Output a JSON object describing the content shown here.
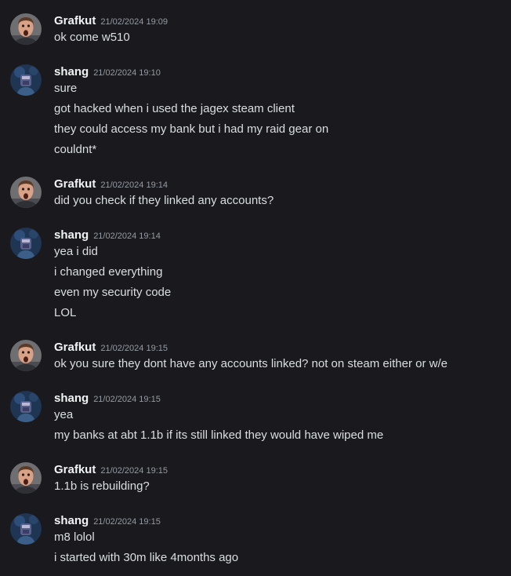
{
  "colors": {
    "background": "#1a1a1e",
    "author": "#f2f3f5",
    "timestamp": "#949ba4",
    "message_text": "#dbdee1"
  },
  "avatars": {
    "grafkut": "man-shocked-face-avatar",
    "shang": "dark-blue-character-avatar"
  },
  "messages": [
    {
      "author": "Grafkut",
      "timestamp": "21/02/2024 19:09",
      "lines": [
        "ok come w510"
      ]
    },
    {
      "author": "shang",
      "timestamp": "21/02/2024 19:10",
      "lines": [
        "sure",
        "got hacked when i used the jagex steam client",
        "they could access my bank but i had my raid gear on",
        "couldnt*"
      ]
    },
    {
      "author": "Grafkut",
      "timestamp": "21/02/2024 19:14",
      "lines": [
        "did you check if they linked any accounts?"
      ]
    },
    {
      "author": "shang",
      "timestamp": "21/02/2024 19:14",
      "lines": [
        "yea i did",
        "i changed everything",
        "even my security code",
        "LOL"
      ]
    },
    {
      "author": "Grafkut",
      "timestamp": "21/02/2024 19:15",
      "lines": [
        "ok you sure they dont have any accounts linked? not on steam either or w/e"
      ]
    },
    {
      "author": "shang",
      "timestamp": "21/02/2024 19:15",
      "lines": [
        "yea",
        "my banks at abt 1.1b if its still linked they would have wiped me"
      ]
    },
    {
      "author": "Grafkut",
      "timestamp": "21/02/2024 19:15",
      "lines": [
        "1.1b is rebuilding?"
      ]
    },
    {
      "author": "shang",
      "timestamp": "21/02/2024 19:15",
      "lines": [
        "m8 lolol",
        "i started with 30m like 4months ago"
      ]
    }
  ]
}
